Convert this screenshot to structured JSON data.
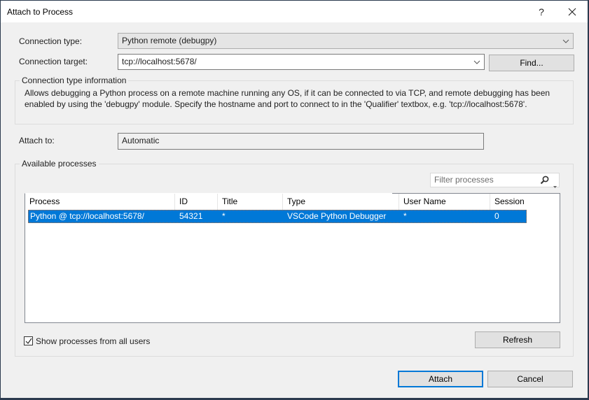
{
  "window": {
    "title": "Attach to Process",
    "help_glyph": "?",
    "close_glyph": "✕"
  },
  "connection": {
    "type_label": "Connection type:",
    "type_value": "Python remote (debugpy)",
    "target_label": "Connection target:",
    "target_value": "tcp://localhost:5678/",
    "find_button": "Find..."
  },
  "info": {
    "group_label": "Connection type information",
    "text": "Allows debugging a Python process on a remote machine running any OS, if it can be connected to via TCP, and remote debugging has been enabled by using the 'debugpy' module. Specify the hostname and port to connect to in the 'Qualifier' textbox, e.g. 'tcp://localhost:5678'."
  },
  "attach_to": {
    "label": "Attach to:",
    "value": "Automatic"
  },
  "processes": {
    "group_label": "Available processes",
    "filter_placeholder": "Filter processes",
    "columns": [
      "Process",
      "ID",
      "Title",
      "Type",
      "User Name",
      "Session"
    ],
    "rows": [
      {
        "process": "Python @ tcp://localhost:5678/",
        "id": "54321",
        "title": "*",
        "type": "VSCode Python Debugger",
        "user_name": "*",
        "session": "0",
        "selected": true
      }
    ],
    "show_all_users_label": "Show processes from all users",
    "show_all_users_checked": true,
    "refresh_button": "Refresh"
  },
  "footer": {
    "attach_button": "Attach",
    "cancel_button": "Cancel"
  },
  "colors": {
    "accent": "#0078d7",
    "frame": "#2b3a4e",
    "background": "#f0f0f0"
  }
}
